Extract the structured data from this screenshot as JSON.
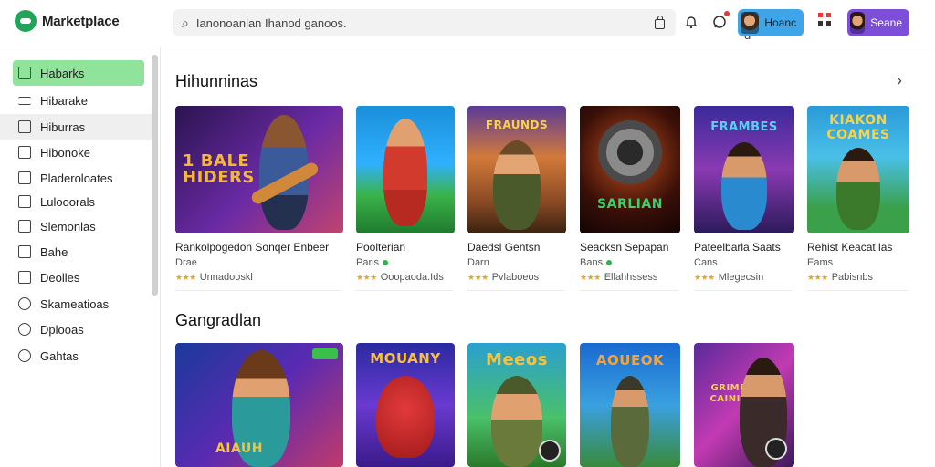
{
  "app": {
    "logo_text": "Marketplace"
  },
  "search": {
    "placeholder": "Ianonoanlan Ihanod ganoos.",
    "voice_label": "Q d"
  },
  "header": {
    "user_chip_1": "Hoanc",
    "user_chip_2": "Seane"
  },
  "icons": {
    "search": "search-icon",
    "bag": "shopping-bag-icon",
    "bell": "bell-icon",
    "chat": "chat-icon",
    "apps": "apps-grid-icon",
    "next": "chevron-right-icon"
  },
  "colors": {
    "brand": "#22a45a",
    "active_item": "#8fe39a",
    "chip_blue": "#3da5e8",
    "chip_purple": "#7d4fd8",
    "star": "#e6a817"
  },
  "sidebar": {
    "items": [
      {
        "label": "Habarks"
      },
      {
        "label": "Hibarake"
      },
      {
        "label": "Hiburras"
      },
      {
        "label": "Hibonoke"
      },
      {
        "label": "Pladeroloates"
      },
      {
        "label": "Lulooorals"
      },
      {
        "label": "Slemonlas"
      },
      {
        "label": "Bahe"
      },
      {
        "label": "Deolles"
      },
      {
        "label": "Skameatioas"
      },
      {
        "label": "Dplooas"
      },
      {
        "label": "Gahtas"
      }
    ]
  },
  "sections": [
    {
      "title": "Hihunninas",
      "cards": [
        {
          "title": "Rankolpogedon Sonqer Enbeer",
          "sub": "Drae",
          "rating": "Unnadooskl",
          "art_text": "1 BALE HIDERS"
        },
        {
          "title": "Poolterian",
          "sub": "Paris",
          "rating": "Ooopaoda.Ids",
          "art_text": ""
        },
        {
          "title": "Daedsl Gentsn",
          "sub": "Darn",
          "rating": "Pvlaboeos",
          "art_text": "FRAUNDS"
        },
        {
          "title": "Seacksn Sepapan",
          "sub": "Bans",
          "rating": "Ellahhssess",
          "art_text": "SARLIAN"
        },
        {
          "title": "Pateelbarla Saats",
          "sub": "Cans",
          "rating": "Mlegecsin",
          "art_text": "FRAMBES"
        },
        {
          "title": "Rehist Keacat las",
          "sub": "Eams",
          "rating": "Pabisnbs",
          "art_text": "KIAKON COAMES"
        }
      ]
    },
    {
      "title": "Gangradlan",
      "cards": [
        {
          "art_text": "AIAUH"
        },
        {
          "art_text": "MOUANY"
        },
        {
          "art_text": "Meeos"
        },
        {
          "art_text": "AOUEOK"
        },
        {
          "art_text": "GRIME CAINIS"
        }
      ]
    }
  ]
}
